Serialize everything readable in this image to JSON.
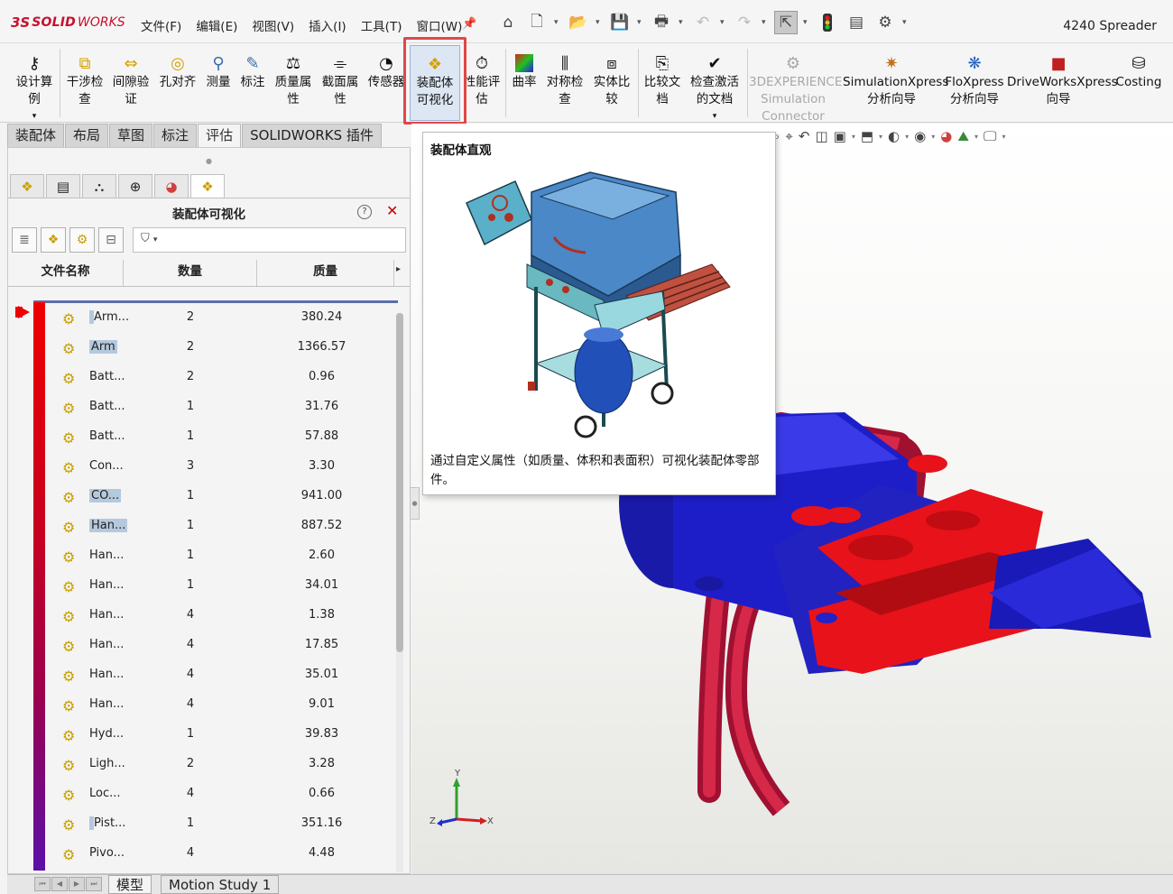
{
  "app": {
    "logo_ds": "3S",
    "logo_solid": "SOLID",
    "logo_works": "WORKS",
    "document_title": "4240 Spreader"
  },
  "menu": [
    "文件(F)",
    "编辑(E)",
    "视图(V)",
    "插入(I)",
    "工具(T)",
    "窗口(W)"
  ],
  "ribbon": {
    "design_study": [
      "设计算",
      "例"
    ],
    "interference": [
      "干涉检",
      "查"
    ],
    "clearance": [
      "间隙验",
      "证"
    ],
    "hole_align": "孔对齐",
    "measure": "测量",
    "markup": "标注",
    "mass_props": [
      "质量属",
      "性"
    ],
    "section_props": [
      "截面属",
      "性"
    ],
    "sensor": "传感器",
    "assembly_vis": [
      "装配体",
      "可视化"
    ],
    "perf_eval": [
      "性能评",
      "估"
    ],
    "curvature": "曲率",
    "symmetry": [
      "对称检",
      "查"
    ],
    "compare_body": [
      "实体比",
      "较"
    ],
    "compare_doc": [
      "比较文",
      "档"
    ],
    "check_active": [
      "检查激活",
      "的文档"
    ],
    "experience": [
      "3DEXPERIENCE",
      "Simulation",
      "Connector"
    ],
    "simxpress": [
      "SimulationXpress",
      "分析向导"
    ],
    "floxpress": [
      "FloXpress",
      "分析向导"
    ],
    "driveworks": [
      "DriveWorksXpress",
      "向导"
    ],
    "costing": "Costing"
  },
  "tabs": [
    "装配体",
    "布局",
    "草图",
    "标注",
    "评估",
    "SOLIDWORKS 插件"
  ],
  "active_tab": "评估",
  "panel": {
    "title": "装配体可视化",
    "help": "?",
    "close": "✕",
    "columns": [
      "文件名称",
      "数量",
      "质量"
    ]
  },
  "rows": [
    {
      "name": "Arm...",
      "qty": "2",
      "mass": "380.24",
      "hl": "partial"
    },
    {
      "name": "Arm",
      "qty": "2",
      "mass": "1366.57",
      "hl": "full"
    },
    {
      "name": "Batt...",
      "qty": "2",
      "mass": "0.96",
      "hl": "none"
    },
    {
      "name": "Batt...",
      "qty": "1",
      "mass": "31.76",
      "hl": "none"
    },
    {
      "name": "Batt...",
      "qty": "1",
      "mass": "57.88",
      "hl": "none"
    },
    {
      "name": "Con...",
      "qty": "3",
      "mass": "3.30",
      "hl": "none"
    },
    {
      "name": "CO...",
      "qty": "1",
      "mass": "941.00",
      "hl": "full"
    },
    {
      "name": "Han...",
      "qty": "1",
      "mass": "887.52",
      "hl": "full"
    },
    {
      "name": "Han...",
      "qty": "1",
      "mass": "2.60",
      "hl": "none"
    },
    {
      "name": "Han...",
      "qty": "1",
      "mass": "34.01",
      "hl": "none"
    },
    {
      "name": "Han...",
      "qty": "4",
      "mass": "1.38",
      "hl": "none"
    },
    {
      "name": "Han...",
      "qty": "4",
      "mass": "17.85",
      "hl": "none"
    },
    {
      "name": "Han...",
      "qty": "4",
      "mass": "35.01",
      "hl": "none"
    },
    {
      "name": "Han...",
      "qty": "4",
      "mass": "9.01",
      "hl": "none"
    },
    {
      "name": "Hyd...",
      "qty": "1",
      "mass": "39.83",
      "hl": "none"
    },
    {
      "name": "Ligh...",
      "qty": "2",
      "mass": "3.28",
      "hl": "none"
    },
    {
      "name": "Loc...",
      "qty": "4",
      "mass": "0.66",
      "hl": "none"
    },
    {
      "name": "Pist...",
      "qty": "1",
      "mass": "351.16",
      "hl": "partial"
    },
    {
      "name": "Pivo...",
      "qty": "4",
      "mass": "4.48",
      "hl": "none"
    }
  ],
  "tooltip": {
    "title": "装配体直观",
    "description": "通过自定义属性（如质量、体积和表面积）可视化装配体零部件。"
  },
  "bottom_tabs": [
    "模型",
    "Motion Study 1"
  ],
  "triad": {
    "x": "X",
    "y": "Y",
    "z": "Z"
  },
  "colors": {
    "highlight_box": "#e04848",
    "gradient_top": "#ee0000",
    "gradient_bottom": "#5a10a8",
    "model_red": "#e8121a",
    "model_blue": "#1c1cc8"
  }
}
